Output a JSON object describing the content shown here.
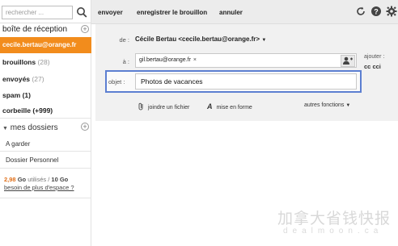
{
  "search": {
    "placeholder": "rechercher ..."
  },
  "sidebar": {
    "inbox_label": "boîte de réception",
    "account": "cecile.bertau@orange.fr",
    "folders": [
      {
        "name": "brouillons",
        "count": "(28)"
      },
      {
        "name": "envoyés",
        "count": "(27)"
      },
      {
        "name": "spam (1)",
        "count": ""
      },
      {
        "name": "corbeille (+999)",
        "count": ""
      }
    ],
    "my_folders_label": "mes dossiers",
    "subfolders": [
      "A garder",
      "Dossier Personnel"
    ],
    "quota": {
      "used": "2,98",
      "unit_used": "Go",
      "used_text": "utilisés /",
      "total": "10 Go",
      "link": "besoin de plus d'espace ?"
    }
  },
  "toolbar": {
    "send": "envoyer",
    "save_draft": "enregistrer le brouillon",
    "cancel": "annuler"
  },
  "compose": {
    "from_label": "de :",
    "from_value": "Cécile Bertau <cecile.bertau@orange.fr>",
    "to_label": "à :",
    "to_recipients": [
      "gil.bertau@orange.fr"
    ],
    "add_label": "ajouter :",
    "cc_label": "cc",
    "cci_label": "cci",
    "subject_label": "objet :",
    "subject_value": "Photos de vacances",
    "attach_label": "joindre un fichier",
    "format_label": "mise en forme",
    "functions_label": "autres fonctions"
  },
  "watermark": {
    "cn": "加拿大省钱快报",
    "en": "dealmoon.ca"
  }
}
